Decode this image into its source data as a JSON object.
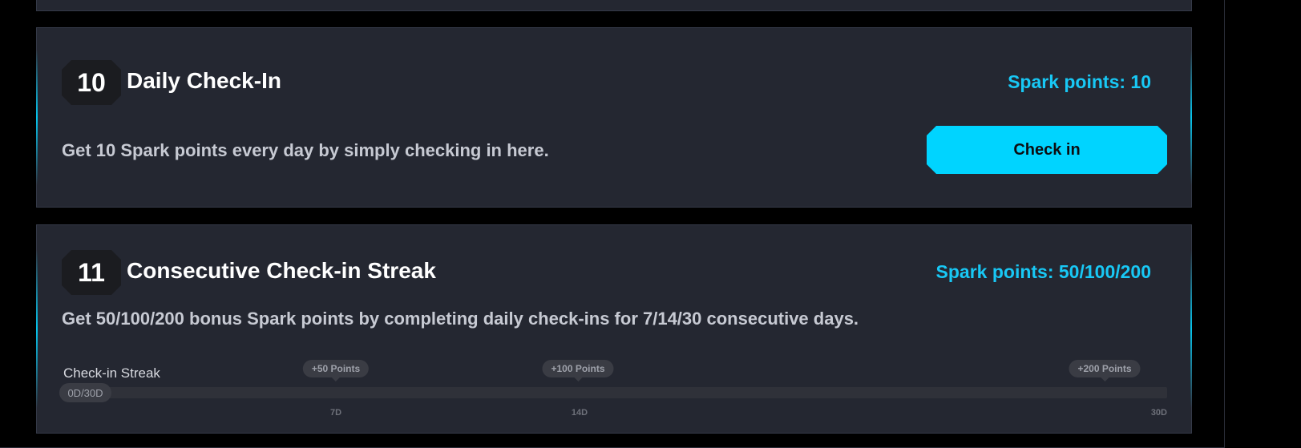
{
  "tasks": [
    {
      "number": "10",
      "title": "Daily Check-In",
      "spark_points": "Spark points: 10",
      "description": "Get 10 Spark points every day by simply checking in here.",
      "button_label": "Check in"
    },
    {
      "number": "11",
      "title": "Consecutive Check-in Streak",
      "spark_points": "Spark points: 50/100/200",
      "description": "Get 50/100/200 bonus Spark points by completing daily check-ins for 7/14/30 consecutive days.",
      "streak": {
        "label": "Check-in Streak",
        "count": "0D/30D",
        "progress_days": 0,
        "total_days": 30,
        "milestones": [
          {
            "reward": "+50 Points",
            "tick": "7D"
          },
          {
            "reward": "+100 Points",
            "tick": "14D"
          },
          {
            "reward": "+200 Points",
            "tick": "30D"
          }
        ]
      }
    }
  ],
  "colors": {
    "accent": "#00d4ff",
    "spark_text": "#18c8f5",
    "card_bg": "#242731",
    "page_bg": "#000000"
  }
}
